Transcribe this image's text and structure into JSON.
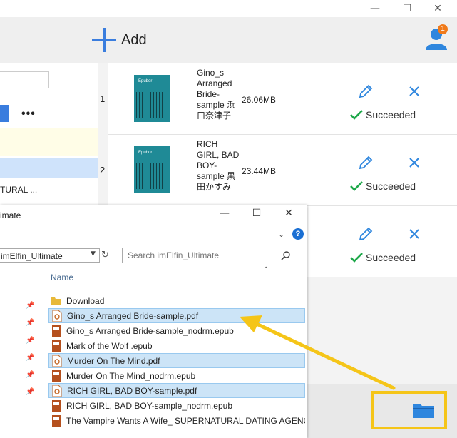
{
  "header": {
    "add_label": "Add",
    "badge_count": "1"
  },
  "left_panel": {
    "row_text": "TURAL ..."
  },
  "books": [
    {
      "index": "1",
      "title": "Gino_s Arranged Bride-sample 浜口奈津子",
      "size": "26.06MB",
      "status": "Succeeded"
    },
    {
      "index": "2",
      "title": "RICH GIRL, BAD BOY-sample 黒田かすみ",
      "size": "23.44MB",
      "status": "Succeeded"
    },
    {
      "index": "",
      "title": "",
      "size": "",
      "status": "Succeeded"
    }
  ],
  "dialog": {
    "title": "imate",
    "address": "imElfin_Ultimate",
    "search_placeholder": "Search imElfin_Ultimate",
    "column_name": "Name",
    "files": [
      {
        "name": "Download",
        "type": "folder",
        "selected": false
      },
      {
        "name": "Gino_s Arranged Bride-sample.pdf",
        "type": "pdf",
        "selected": true
      },
      {
        "name": "Gino_s Arranged Bride-sample_nodrm.epub",
        "type": "epub",
        "selected": false
      },
      {
        "name": "Mark of the Wolf .epub",
        "type": "epub",
        "selected": false
      },
      {
        "name": "Murder On The Mind.pdf",
        "type": "pdf",
        "selected": true
      },
      {
        "name": "Murder On The Mind_nodrm.epub",
        "type": "epub",
        "selected": false
      },
      {
        "name": "RICH GIRL, BAD BOY-sample.pdf",
        "type": "pdf",
        "selected": true
      },
      {
        "name": "RICH GIRL, BAD BOY-sample_nodrm.epub",
        "type": "epub",
        "selected": false
      },
      {
        "name": "The Vampire Wants A Wife_ SUPERNATURAL DATING AGENCY –",
        "type": "epub",
        "selected": false
      }
    ]
  },
  "colors": {
    "accent": "#3a7dde",
    "highlight": "#f5c518",
    "success": "#1ea84a",
    "badge": "#f07a1a",
    "cover": "#1f8a96"
  },
  "icons": [
    "plus-icon",
    "user-icon",
    "edit-icon",
    "close-icon",
    "check-icon",
    "folder-icon",
    "pdf-icon",
    "epub-icon",
    "search-icon",
    "refresh-icon",
    "pin-icon",
    "help-icon"
  ]
}
